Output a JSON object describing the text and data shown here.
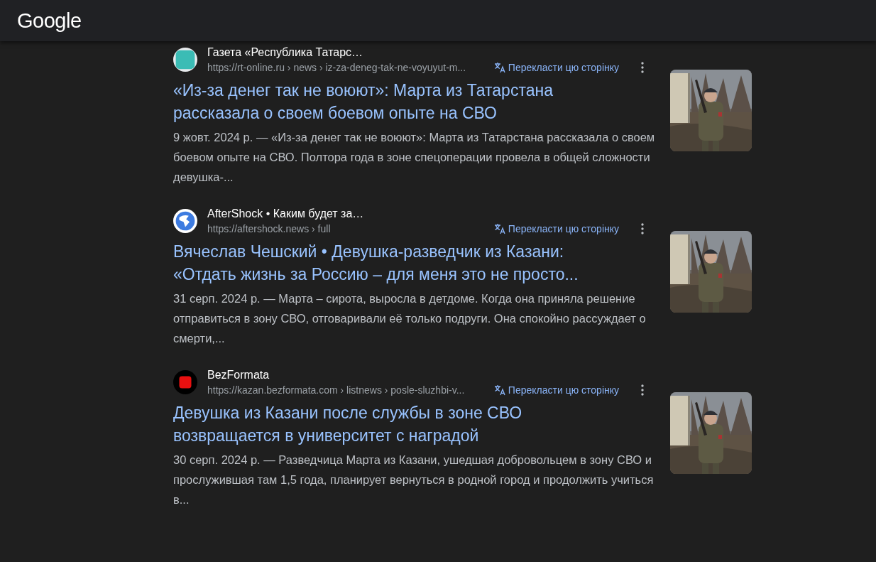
{
  "header": {
    "logo": "Google"
  },
  "results": [
    {
      "favicon": {
        "kind": "teal"
      },
      "site": "Газета «Республика Татарс…",
      "url": "https://rt-online.ru › news › iz-za-deneg-tak-ne-voyuyut-m...",
      "translate": "Перекласти цю сторінку",
      "title": "«Из-за денег так не воюют»: Марта из Татарстана рассказала о своем боевом опыте на СВО",
      "snippet": "9 жовт. 2024 р. — «Из-за денег так не воюют»: Марта из Татарстана рассказала о своем боевом опыте на СВО. Полтора года в зоне спецоперации провела в общей сложности девушка-..."
    },
    {
      "favicon": {
        "kind": "globe"
      },
      "site": "AfterShock • Каким будет за…",
      "url": "https://aftershock.news › full",
      "translate": "Перекласти цю сторінку",
      "title": "Вячеслав Чешский • Девушка-разведчик из Казани: «Отдать жизнь за Россию – для меня это не просто...",
      "snippet": "31 серп. 2024 р. — Марта – сирота, выросла в детдоме. Когда она приняла решение отправиться в зону СВО, отговаривали её только подруги. Она спокойно рассуждает о смерти,..."
    },
    {
      "favicon": {
        "kind": "red"
      },
      "site": "BezFormata",
      "url": "https://kazan.bezformata.com › listnews › posle-sluzhbi-v...",
      "translate": "Перекласти цю сторінку",
      "title": "Девушка из Казани после службы в зоне СВО возвращается в университет с наградой",
      "snippet": "30 серп. 2024 р. — Разведчица Марта из Казани, ушедшая добровольцем в зону СВО и прослужившая там 1,5 года, планирует вернуться в родной город и продолжить учиться в..."
    }
  ]
}
